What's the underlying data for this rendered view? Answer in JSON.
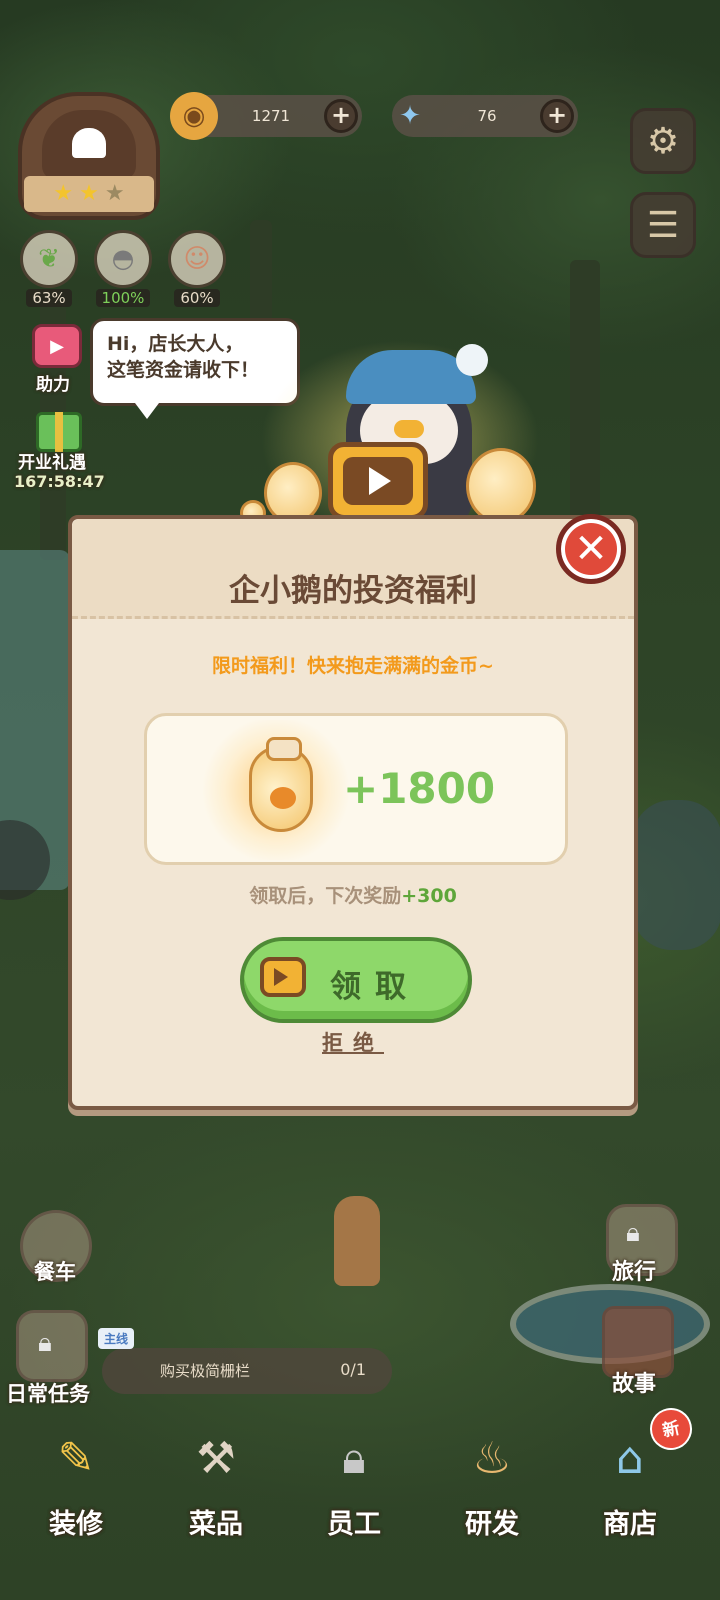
{
  "hud": {
    "coins": "1271",
    "gems": "76",
    "stats": [
      {
        "icon": "leaf-icon",
        "value": "63%"
      },
      {
        "icon": "cloche-icon",
        "value": "100%"
      },
      {
        "icon": "smile-icon",
        "value": "60%"
      }
    ]
  },
  "side_left": {
    "help_label": "助力",
    "opening_gift_label": "开业礼遇",
    "opening_gift_timer": "167:58:47",
    "food_truck_label": "餐车",
    "daily_tasks_label": "日常任务"
  },
  "side_right": {
    "travel_label": "旅行",
    "story_label": "故事"
  },
  "speech_bubble": {
    "line1": "Hi，店长大人，",
    "line2": "这笔资金请收下！"
  },
  "modal": {
    "title": "企小鹅的投资福利",
    "subtitle": "限时福利！快来抱走满满的金币~",
    "reward_amount": "+1800",
    "next_reward_prefix": "领取后，下次奖励",
    "next_reward_value": "+300",
    "claim_label": "领取",
    "refuse_label": "拒绝"
  },
  "quest": {
    "tag": "主线",
    "name": "购买极简栅栏",
    "progress": "0/1"
  },
  "bottom_nav": [
    {
      "label": "装修",
      "icon": "brush-icon",
      "locked": false
    },
    {
      "label": "菜品",
      "icon": "utensils-icon",
      "locked": false
    },
    {
      "label": "员工",
      "icon": "clipboard-icon",
      "locked": true
    },
    {
      "label": "研发",
      "icon": "pot-icon",
      "locked": false
    },
    {
      "label": "商店",
      "icon": "shop-icon",
      "locked": false,
      "badge": "新"
    }
  ],
  "colors": {
    "accent_orange": "#f39a1c",
    "reward_green": "#7cc45a",
    "close_red": "#e04a3a",
    "claim_green": "#8ed86a"
  }
}
